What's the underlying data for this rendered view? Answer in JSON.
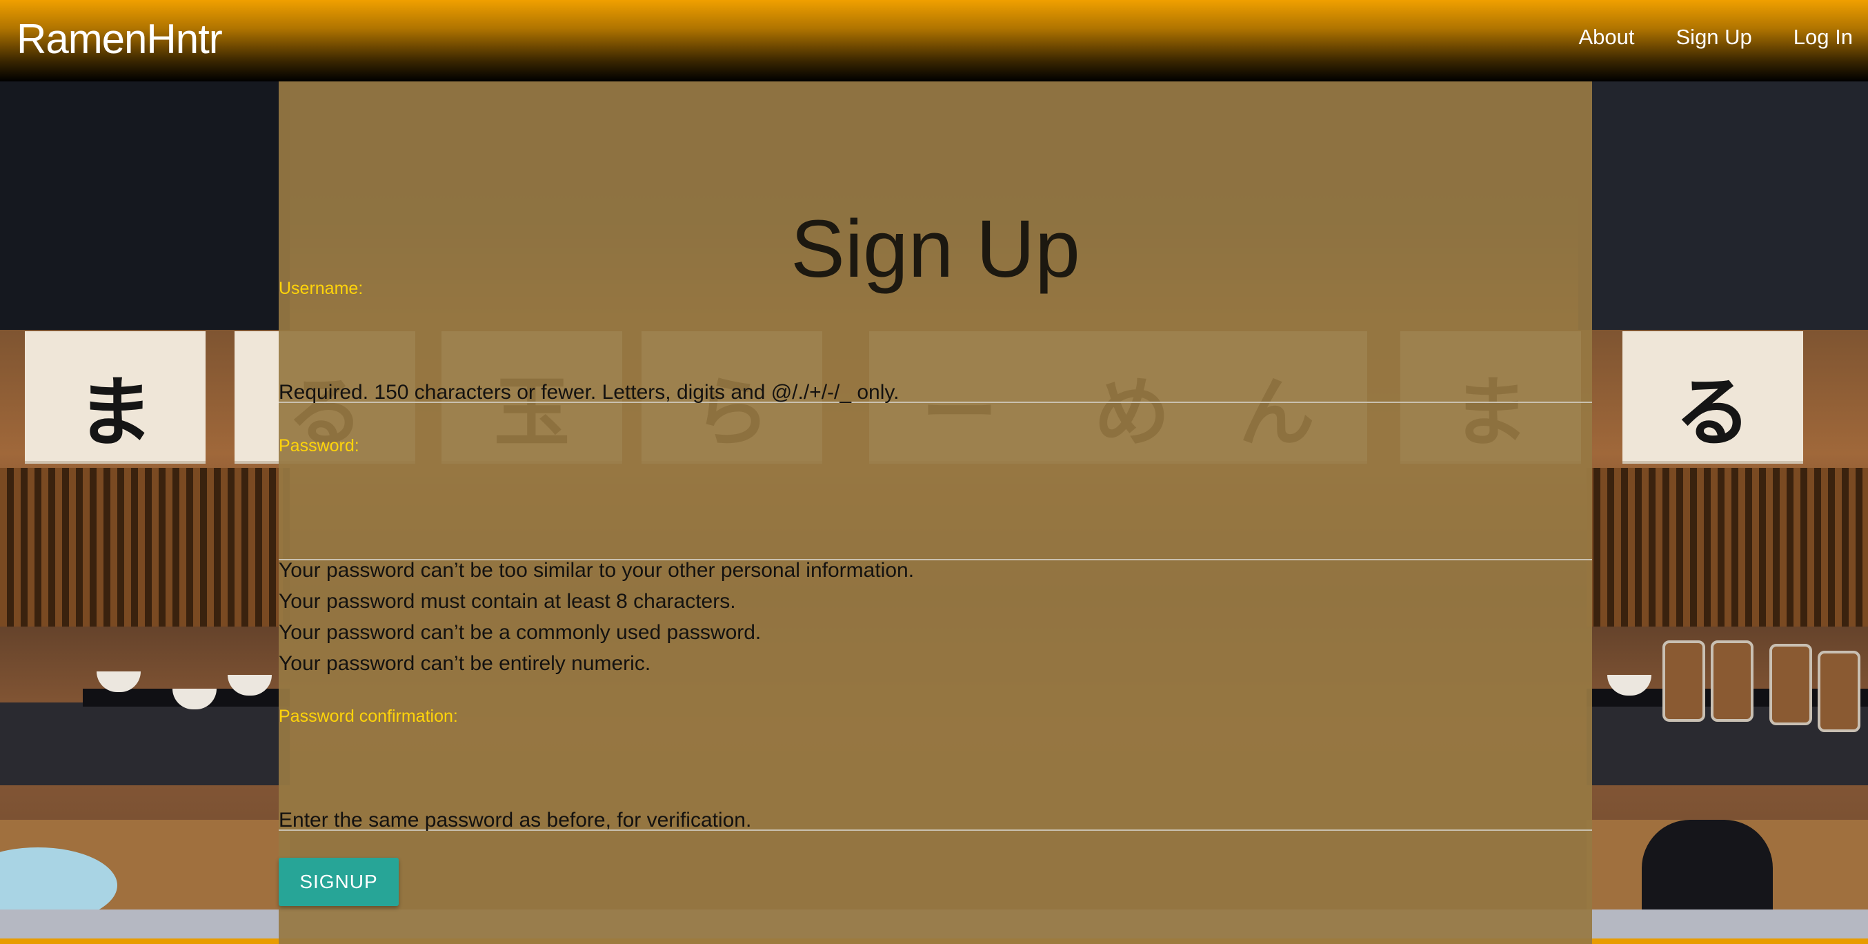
{
  "navbar": {
    "brand": "RamenHntr",
    "links": [
      {
        "label": "About"
      },
      {
        "label": "Sign Up"
      },
      {
        "label": "Log In"
      }
    ],
    "gradient_colors": [
      "#f0a000",
      "#000000"
    ]
  },
  "background": {
    "noren_characters": [
      "ま",
      "る",
      "玉",
      "ら",
      "ー",
      "め",
      "ん",
      "ま",
      "る"
    ]
  },
  "form": {
    "title": "Sign Up",
    "username": {
      "label": "Username:",
      "value": "",
      "help": "Required. 150 characters or fewer. Letters, digits and @/./+/-/_ only."
    },
    "password": {
      "label": "Password:",
      "value": "",
      "help": [
        "Your password can’t be too similar to your other personal information.",
        "Your password must contain at least 8 characters.",
        "Your password can’t be a commonly used password.",
        "Your password can’t be entirely numeric."
      ]
    },
    "password_confirmation": {
      "label": "Password confirmation:",
      "value": "",
      "help": "Enter the same password as before, for verification."
    },
    "submit_label": "SIGNUP"
  },
  "colors": {
    "label": "#ffd40a",
    "panel": "#977943",
    "button": "#27a597",
    "accent_bar": "#e89c00"
  }
}
